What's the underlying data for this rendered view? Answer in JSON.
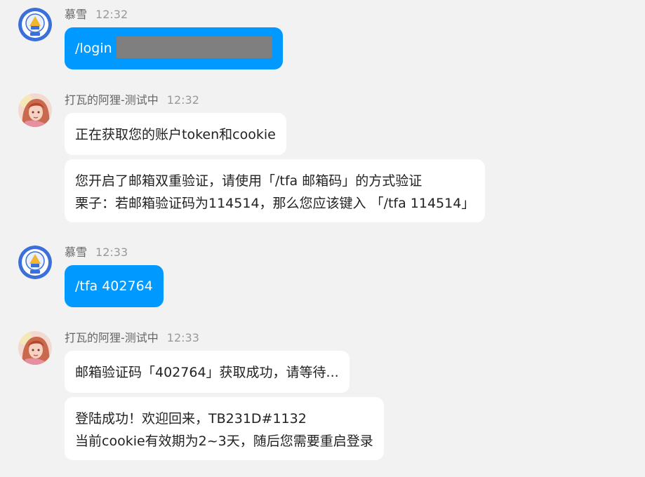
{
  "messages": [
    {
      "sender": "慕雪",
      "time": "12:32",
      "avatar": "moxue-avatar",
      "self": true,
      "bubbles": [
        {
          "lines": [
            "/login"
          ],
          "redacted": true
        }
      ]
    },
    {
      "sender": "打瓦的阿狸-测试中",
      "time": "12:32",
      "avatar": "ahri-avatar",
      "self": false,
      "bubbles": [
        {
          "lines": [
            "正在获取您的账户token和cookie"
          ]
        },
        {
          "lines": [
            "您开启了邮箱双重验证，请使用「/tfa 邮箱码」的方式验证",
            "栗子：若邮箱验证码为114514，那么您应该键入 「/tfa 114514」"
          ]
        }
      ]
    },
    {
      "sender": "慕雪",
      "time": "12:33",
      "avatar": "moxue-avatar",
      "self": true,
      "bubbles": [
        {
          "lines": [
            "/tfa 402764"
          ]
        }
      ]
    },
    {
      "sender": "打瓦的阿狸-测试中",
      "time": "12:33",
      "avatar": "ahri-avatar",
      "self": false,
      "bubbles": [
        {
          "lines": [
            "邮箱验证码「402764」获取成功，请等待..."
          ]
        },
        {
          "lines": [
            "登陆成功！欢迎回来，TB231D#1132",
            "当前cookie有效期为2~3天，随后您需要重启登录"
          ]
        }
      ]
    }
  ],
  "colors": {
    "background": "#f2f2f2",
    "self_bubble": "#0099ff",
    "other_bubble": "#ffffff",
    "redaction": "#7f7f7f"
  }
}
